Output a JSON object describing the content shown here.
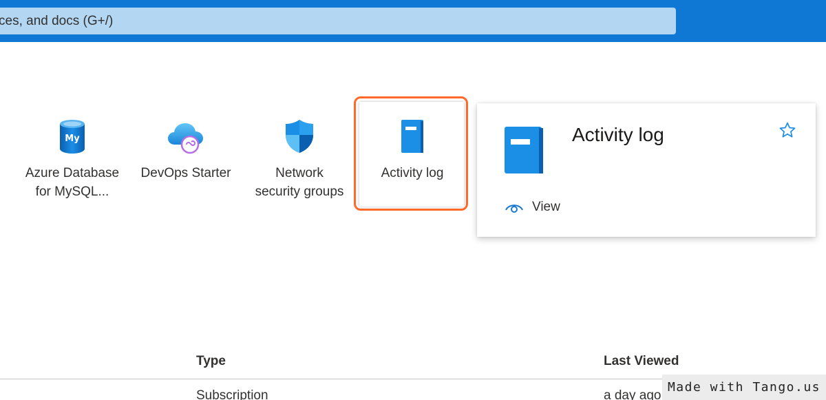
{
  "header": {
    "search_placeholder": "ces, and docs (G+/)"
  },
  "services": [
    {
      "label_line1": "Azure Database",
      "label_line2": "for MySQL...",
      "icon": "mysql-database-icon"
    },
    {
      "label_line1": "DevOps Starter",
      "label_line2": "",
      "icon": "devops-starter-icon"
    },
    {
      "label_line1": "Network",
      "label_line2": "security groups",
      "icon": "network-security-shield-icon"
    },
    {
      "label_line1": "Activity log",
      "label_line2": "",
      "icon": "activity-log-book-icon"
    }
  ],
  "hover_card": {
    "title": "Activity log",
    "view_label": "View",
    "icons": [
      "activity-log-book-icon",
      "star-icon",
      "eye-icon"
    ]
  },
  "resources_table": {
    "columns": [
      "Type",
      "Last Viewed"
    ],
    "rows": [
      {
        "type": "Subscription",
        "last_viewed": "a day ago"
      }
    ]
  },
  "watermark": "Made with Tango.us",
  "colors": {
    "topbar": "#0f78d4",
    "search_box": "#b3d6f2",
    "highlight": "#ff6a2b",
    "icon_blue": "#1b8ee6"
  }
}
